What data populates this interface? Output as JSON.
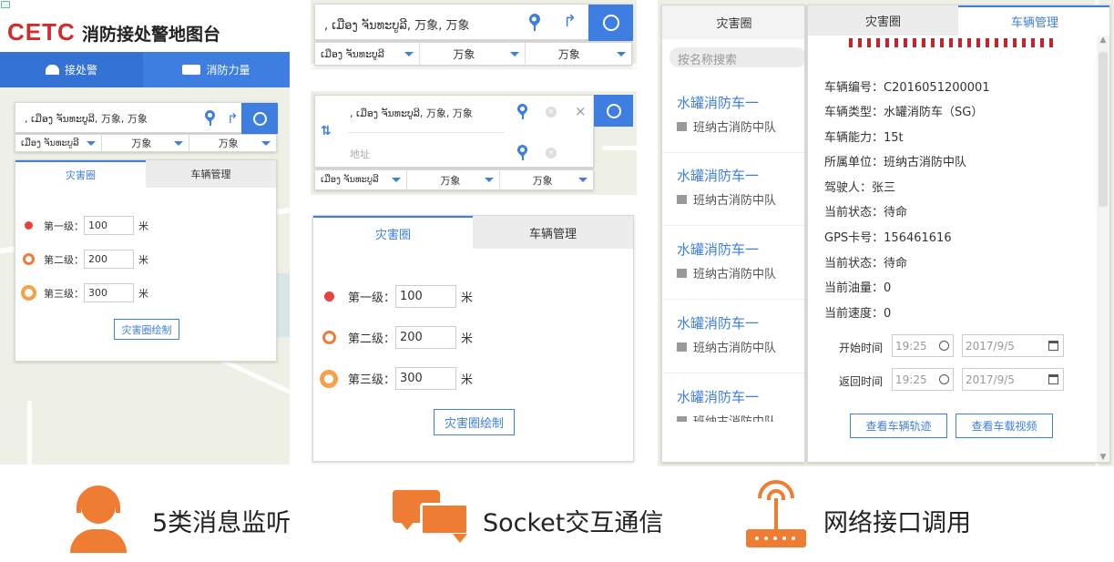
{
  "panel1": {
    "logo": "CETC",
    "app_title": "消防接处警地图台",
    "nav": [
      {
        "label": "接处警",
        "icon": "alarm-icon"
      },
      {
        "label": "消防力量",
        "icon": "fire-truck-icon"
      }
    ],
    "search_value": ", ເມືອງ ຈັນທະບູລີ, 万象, 万象",
    "dropdowns": [
      "ເມືອງ ຈັນທະບູລີ",
      "万象",
      "万象"
    ],
    "tabs": [
      "灾害圈",
      "车辆管理"
    ],
    "levels": [
      {
        "label": "第一级：",
        "value": "100",
        "unit": "米",
        "color": "#e64340"
      },
      {
        "label": "第二级：",
        "value": "200",
        "unit": "米",
        "color": "#f07a3a"
      },
      {
        "label": "第三级：",
        "value": "300",
        "unit": "米",
        "color": "#f5a14a"
      }
    ],
    "draw_button": "灾害圈绘制"
  },
  "panel2": {
    "search_value": ", ເມືອງ ຈັນທະບູລີ, 万象, 万象",
    "dropdowns": [
      "ເມືອງ ຈັນທະບູລີ",
      "万象",
      "万象"
    ]
  },
  "panel3": {
    "from_value": ", ເມືອງ ຈັນທະບູລີ, 万象, 万象",
    "to_placeholder": "地址",
    "dropdowns": [
      "ເມືອງ ຈັນທະບູລີ",
      "万象",
      "万象"
    ]
  },
  "panel4": {
    "tabs": [
      "灾害圈",
      "车辆管理"
    ],
    "levels": [
      {
        "label": "第一级：",
        "value": "100",
        "unit": "米"
      },
      {
        "label": "第二级：",
        "value": "200",
        "unit": "米"
      },
      {
        "label": "第三级：",
        "value": "300",
        "unit": "米"
      }
    ],
    "draw_button": "灾害圈绘制"
  },
  "panel5": {
    "tabs": [
      "灾害圈",
      "车辆管理"
    ],
    "search_placeholder": "按名称搜索",
    "vehicles": [
      {
        "name": "水罐消防车一",
        "unit": "班纳古消防中队"
      },
      {
        "name": "水罐消防车一",
        "unit": "班纳古消防中队"
      },
      {
        "name": "水罐消防车一",
        "unit": "班纳古消防中队"
      },
      {
        "name": "水罐消防车一",
        "unit": "班纳古消防中队"
      },
      {
        "name": "水罐消防车一",
        "unit": "班纳古消防中队"
      }
    ],
    "details": [
      "车辆编号：C2016051200001",
      "车辆类型：水罐消防车（SG）",
      "车辆能力：15t",
      "所属单位：班纳古消防中队",
      "驾驶人：张三",
      "当前状态：待命",
      "GPS卡号：156461616",
      "当前状态：待命",
      "当前油量：0",
      "当前速度：0"
    ],
    "start_label": "开始时间",
    "return_label": "返回时间",
    "time_value": "19:25",
    "date_value": "2017/9/5",
    "track_button": "查看车辆轨迹",
    "video_button": "查看车载视频"
  },
  "features": [
    {
      "label": "5类消息监听",
      "icon": "headset-operator-icon"
    },
    {
      "label": "Socket交互通信",
      "icon": "chat-bubbles-icon"
    },
    {
      "label": "网络接口调用",
      "icon": "wifi-router-icon"
    }
  ],
  "colors": {
    "accent": "#3e7ee0",
    "feature_icon": "#ee7d33",
    "level1": "#e64340",
    "level2": "#f07a3a",
    "level3": "#f5a14a"
  }
}
